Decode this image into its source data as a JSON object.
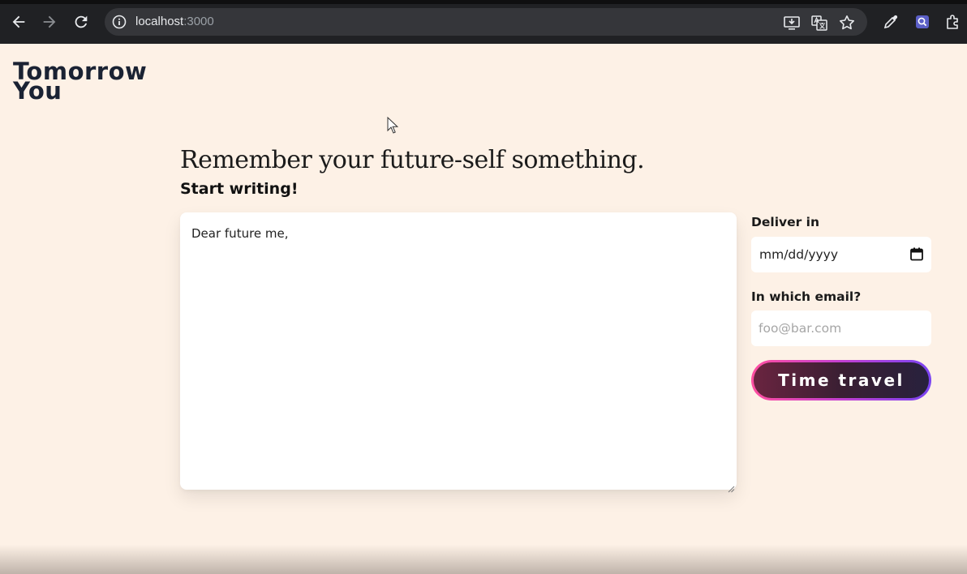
{
  "browser": {
    "url_host": "localhost",
    "url_port": ":3000"
  },
  "app": {
    "logo_line1": "Tomorrow",
    "logo_line2": "You"
  },
  "main": {
    "headline": "Remember your future-self something.",
    "subheading": "Start writing!",
    "letter_value": "Dear future me,"
  },
  "form": {
    "deliver_label": "Deliver in",
    "date_value": "mm/dd/yyyy",
    "email_label": "In which email?",
    "email_placeholder": "foo@bar.com",
    "submit_label": "Time travel"
  },
  "colors": {
    "page_background": "#fdf1e6",
    "logo_text": "#1a2233",
    "button_gradient_start": "#ff4fa0",
    "button_gradient_end": "#7a44f2"
  }
}
